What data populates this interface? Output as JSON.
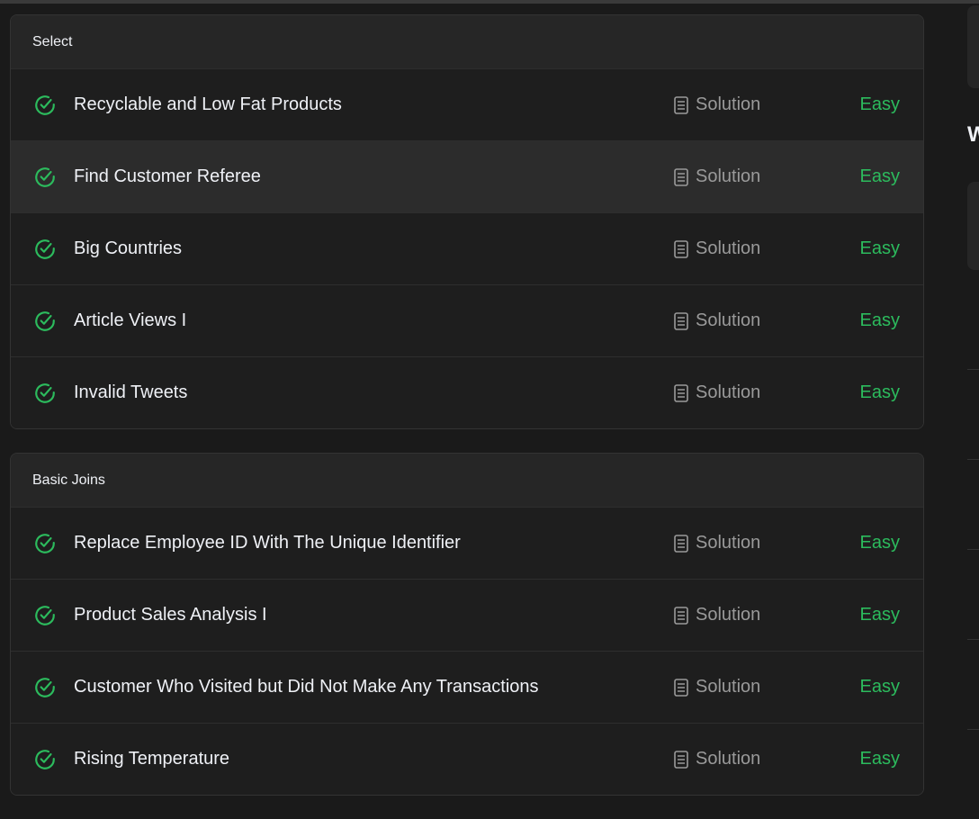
{
  "sections": [
    {
      "title": "Select",
      "problems": [
        {
          "title": "Recyclable and Low Fat Products",
          "solution": "Solution",
          "difficulty": "Easy"
        },
        {
          "title": "Find Customer Referee",
          "solution": "Solution",
          "difficulty": "Easy"
        },
        {
          "title": "Big Countries",
          "solution": "Solution",
          "difficulty": "Easy"
        },
        {
          "title": "Article Views I",
          "solution": "Solution",
          "difficulty": "Easy"
        },
        {
          "title": "Invalid Tweets",
          "solution": "Solution",
          "difficulty": "Easy"
        }
      ]
    },
    {
      "title": "Basic Joins",
      "problems": [
        {
          "title": "Replace Employee ID With The Unique Identifier",
          "solution": "Solution",
          "difficulty": "Easy"
        },
        {
          "title": "Product Sales Analysis I",
          "solution": "Solution",
          "difficulty": "Easy"
        },
        {
          "title": "Customer Who Visited but Did Not Make Any Transactions",
          "solution": "Solution",
          "difficulty": "Easy"
        },
        {
          "title": "Rising Temperature",
          "solution": "Solution",
          "difficulty": "Easy"
        }
      ]
    }
  ],
  "right_panel": {
    "heading_letter": "W"
  },
  "colors": {
    "accent_easy": "#2cbb5d",
    "check": "#2cbb5d",
    "background": "#1a1a1a"
  },
  "icons": {
    "status": "check-circle-icon",
    "solution": "document-icon"
  }
}
